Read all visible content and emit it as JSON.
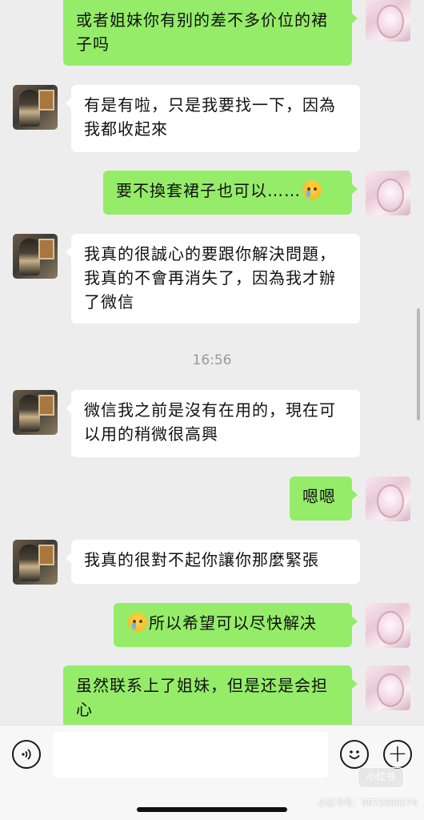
{
  "messages": [
    {
      "side": "self",
      "text": "或者姐妹你有别的差不多价位的裙子吗"
    },
    {
      "side": "other",
      "text": "有是有啦，只是我要找一下，因為我都收起來"
    },
    {
      "side": "self",
      "text": "要不換套裙子也可以……",
      "emoji_after": "crying-face"
    },
    {
      "side": "other",
      "text": "我真的很誠心的要跟你解決問題，我真的不會再消失了，因為我才辦了微信"
    },
    {
      "side": "other",
      "text": "微信我之前是沒有在用的，現在可以用的稍微很高興"
    },
    {
      "side": "self",
      "text": "嗯嗯"
    },
    {
      "side": "other",
      "text": "我真的很對不起你讓你那麼緊張"
    },
    {
      "side": "self",
      "text": "所以希望可以尽快解决",
      "emoji_before": "crying-face"
    },
    {
      "side": "self",
      "text": "虽然联系上了姐妹，但是还是会担心"
    }
  ],
  "timestamp": "16:56",
  "input": {
    "value": "",
    "placeholder": ""
  },
  "watermark": {
    "logo": "小红书",
    "id": "小红书号：8873388276"
  },
  "colors": {
    "self_bubble": "#95ec69",
    "other_bubble": "#ffffff",
    "background": "#ededed"
  }
}
